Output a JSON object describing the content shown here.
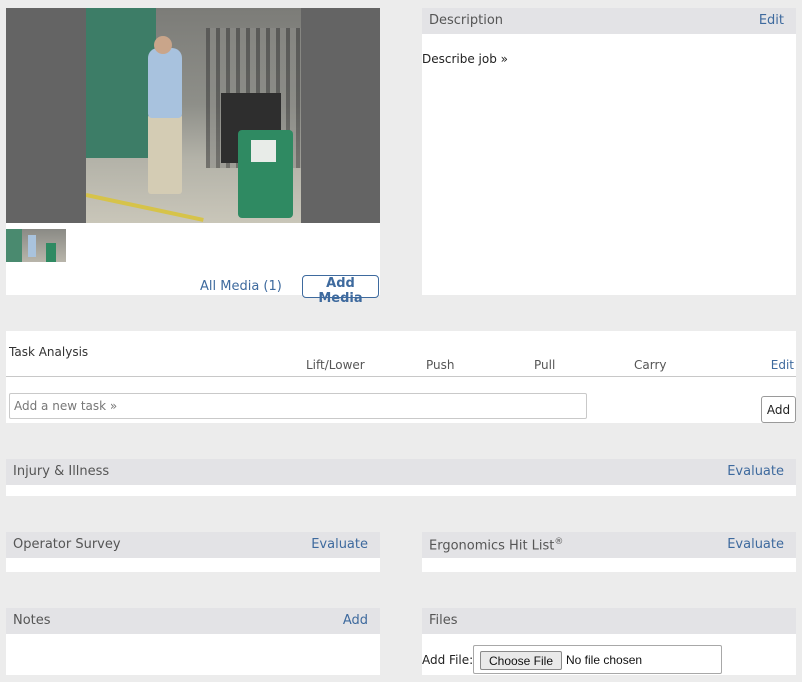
{
  "media": {
    "all_media_label": "All Media (1)",
    "add_media_label": "Add Media"
  },
  "description": {
    "title": "Description",
    "edit_label": "Edit",
    "describe_link": "Describe job »"
  },
  "task_analysis": {
    "title": "Task Analysis",
    "columns": [
      "Lift/Lower",
      "Push",
      "Pull",
      "Carry"
    ],
    "edit_label": "Edit",
    "new_task_placeholder": "Add a new task »",
    "add_label": "Add"
  },
  "injury": {
    "title": "Injury & Illness",
    "action_label": "Evaluate"
  },
  "operator_survey": {
    "title": "Operator Survey",
    "action_label": "Evaluate"
  },
  "hit_list": {
    "title": "Ergonomics Hit List",
    "superscript": "®",
    "action_label": "Evaluate"
  },
  "notes": {
    "title": "Notes",
    "action_label": "Add"
  },
  "files": {
    "title": "Files",
    "add_file_label": "Add File:",
    "choose_file_label": "Choose File",
    "no_file_text": "No file chosen"
  },
  "colors": {
    "link": "#3e6a9e",
    "header_bg": "#e3e3e6",
    "page_bg": "#ececec"
  }
}
